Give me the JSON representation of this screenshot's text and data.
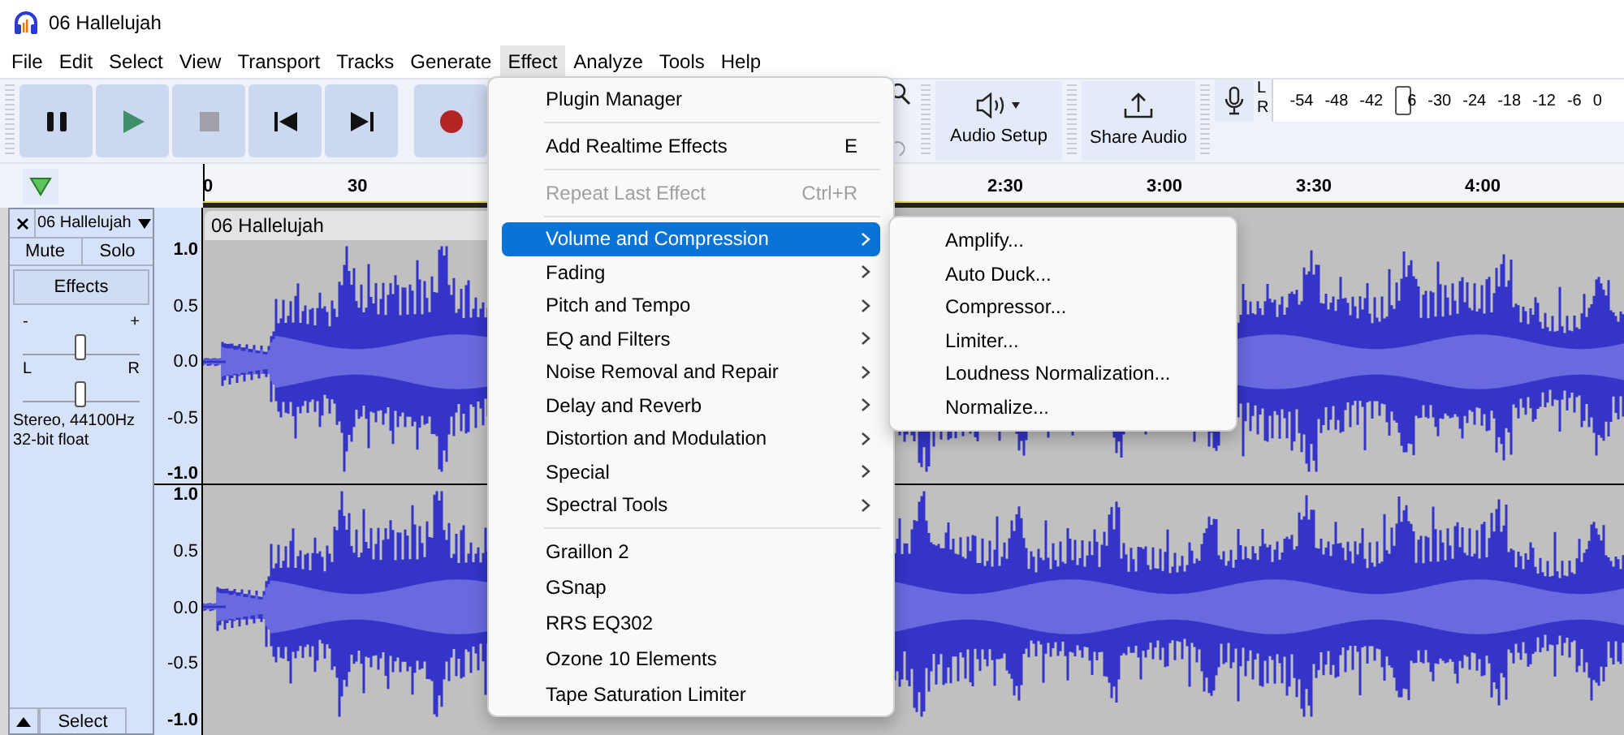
{
  "window": {
    "title": "06 Hallelujah"
  },
  "menu_bar": [
    {
      "label": "File",
      "selected": false
    },
    {
      "label": "Edit",
      "selected": false
    },
    {
      "label": "Select",
      "selected": false
    },
    {
      "label": "View",
      "selected": false
    },
    {
      "label": "Transport",
      "selected": false
    },
    {
      "label": "Tracks",
      "selected": false
    },
    {
      "label": "Generate",
      "selected": false
    },
    {
      "label": "Effect",
      "selected": true
    },
    {
      "label": "Analyze",
      "selected": false
    },
    {
      "label": "Tools",
      "selected": false
    },
    {
      "label": "Help",
      "selected": false
    }
  ],
  "transport_buttons": [
    {
      "kind": "pause"
    },
    {
      "kind": "play"
    },
    {
      "kind": "stop"
    },
    {
      "kind": "skip_start"
    },
    {
      "kind": "skip_end"
    },
    {
      "kind": "record"
    }
  ],
  "toolbar": {
    "audio_setup": "Audio Setup",
    "share_audio": "Share Audio"
  },
  "meter": {
    "left": "L",
    "right": "R",
    "ticks_before": [
      "-54",
      "-48",
      "-42"
    ],
    "ticks_after": [
      "6",
      "-30",
      "-24",
      "-18",
      "-12",
      "-6",
      "0"
    ]
  },
  "timeline": {
    "ticks": [
      "0",
      "30",
      "2:30",
      "3:00",
      "3:30",
      "4:00"
    ]
  },
  "track": {
    "name": "06 Hallelujah",
    "mute": "Mute",
    "solo": "Solo",
    "effects": "Effects",
    "gain": {
      "minus": "-",
      "plus": "+",
      "level": 0.5
    },
    "pan": {
      "left": "L",
      "right": "R",
      "level": 0.5
    },
    "info": [
      "Stereo, 44100Hz",
      "32-bit float"
    ],
    "select": "Select",
    "clip_title": "06 Hallelujah",
    "channels": [
      {
        "scale": [
          "1.0",
          "0.5",
          "0.0",
          "-0.5",
          "-1.0"
        ]
      },
      {
        "scale": [
          "1.0",
          "0.5",
          "0.0",
          "-0.5",
          "-1.0"
        ]
      }
    ]
  },
  "effect_menu": {
    "items": [
      {
        "kind": "item",
        "label": "Plugin Manager",
        "disabled": false,
        "selected": false
      },
      {
        "kind": "separator"
      },
      {
        "kind": "item",
        "label": "Add Realtime Effects",
        "shortcut": "E",
        "disabled": false,
        "selected": false
      },
      {
        "kind": "separator"
      },
      {
        "kind": "item",
        "label": "Repeat Last Effect",
        "shortcut": "Ctrl+R",
        "disabled": true,
        "selected": false
      },
      {
        "kind": "separator"
      },
      {
        "kind": "submenu",
        "label": "Volume and Compression",
        "selected": true
      },
      {
        "kind": "submenu",
        "label": "Fading",
        "selected": false
      },
      {
        "kind": "submenu",
        "label": "Pitch and Tempo",
        "selected": false
      },
      {
        "kind": "submenu",
        "label": "EQ and Filters",
        "selected": false
      },
      {
        "kind": "submenu",
        "label": "Noise Removal and Repair",
        "selected": false
      },
      {
        "kind": "submenu",
        "label": "Delay and Reverb",
        "selected": false
      },
      {
        "kind": "submenu",
        "label": "Distortion and Modulation",
        "selected": false
      },
      {
        "kind": "submenu",
        "label": "Special",
        "selected": false
      },
      {
        "kind": "submenu",
        "label": "Spectral Tools",
        "selected": false
      },
      {
        "kind": "separator"
      },
      {
        "kind": "item",
        "label": "Graillon 2",
        "disabled": false,
        "selected": false
      },
      {
        "kind": "item",
        "label": "GSnap",
        "disabled": false,
        "selected": false
      },
      {
        "kind": "item",
        "label": "RRS EQ302",
        "disabled": false,
        "selected": false
      },
      {
        "kind": "item",
        "label": "Ozone 10 Elements",
        "disabled": false,
        "selected": false
      },
      {
        "kind": "item",
        "label": "Tape Saturation Limiter",
        "disabled": false,
        "selected": false
      }
    ],
    "submenu": [
      "Amplify...",
      "Auto Duck...",
      "Compressor...",
      "Limiter...",
      "Loudness Normalization...",
      "Normalize..."
    ]
  }
}
